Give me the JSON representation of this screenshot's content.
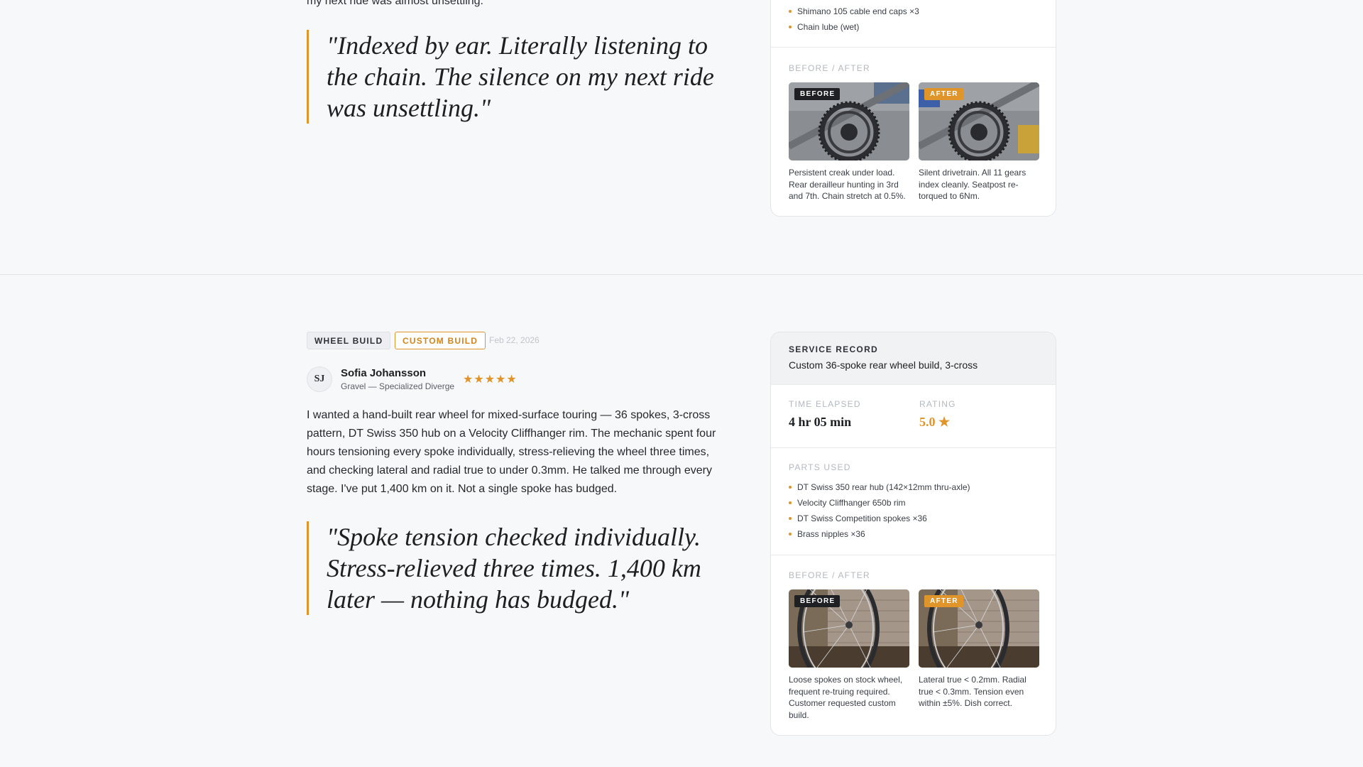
{
  "review1": {
    "body_tail": "my next ride was almost unsettling.",
    "quote": "\"Indexed by ear. Literally listening to the chain. The silence on my next ride was unsettling.\"",
    "card": {
      "parts_tail": [
        "Shimano 105 cable end caps ×3",
        "Chain lube (wet)"
      ],
      "before_after_label": "BEFORE / AFTER",
      "before": {
        "badge": "BEFORE",
        "caption": "Persistent creak under load. Rear derailleur hunting in 3rd and 7th. Chain stretch at 0.5%."
      },
      "after": {
        "badge": "AFTER",
        "caption": "Silent drivetrain. All 11 gears index cleanly. Seatpost re-torqued to 6Nm."
      }
    }
  },
  "review2": {
    "tags": [
      "WHEEL BUILD",
      "CUSTOM BUILD"
    ],
    "date": "Feb 22, 2026",
    "avatar_initials": "SJ",
    "name": "Sofia Johansson",
    "bike": "Gravel — Specialized Diverge",
    "stars": "★★★★★",
    "rating_value": 5,
    "body": "I wanted a hand-built rear wheel for mixed-surface touring — 36 spokes, 3-cross pattern, DT Swiss 350 hub on a Velocity Cliffhanger rim. The mechanic spent four hours tensioning every spoke individually, stress-relieving the wheel three times, and checking lateral and radial true to under 0.3mm. He talked me through every stage. I've put 1,400 km on it. Not a single spoke has budged.",
    "quote": "\"Spoke tension checked individually. Stress-relieved three times. 1,400 km later — nothing has budged.\"",
    "card": {
      "record_label": "SERVICE RECORD",
      "record_title": "Custom 36-spoke rear wheel build, 3-cross",
      "time_label": "TIME ELAPSED",
      "time_value": "4 hr 05 min",
      "rating_label": "RATING",
      "rating_display": "5.0 ★",
      "parts_label": "PARTS USED",
      "parts": [
        "DT Swiss 350 rear hub (142×12mm thru-axle)",
        "Velocity Cliffhanger 650b rim",
        "DT Swiss Competition spokes ×36",
        "Brass nipples ×36"
      ],
      "before_after_label": "BEFORE / AFTER",
      "before": {
        "badge": "BEFORE",
        "caption": "Loose spokes on stock wheel, frequent re-truing required. Customer requested custom build."
      },
      "after": {
        "badge": "AFTER",
        "caption": "Lateral true < 0.2mm. Radial true < 0.3mm. Tension even within ±5%. Dish correct."
      }
    }
  },
  "colors": {
    "accent": "#e0952a",
    "background": "#f7f8fa",
    "card": "#ffffff",
    "dark_badge": "#1e2024"
  }
}
